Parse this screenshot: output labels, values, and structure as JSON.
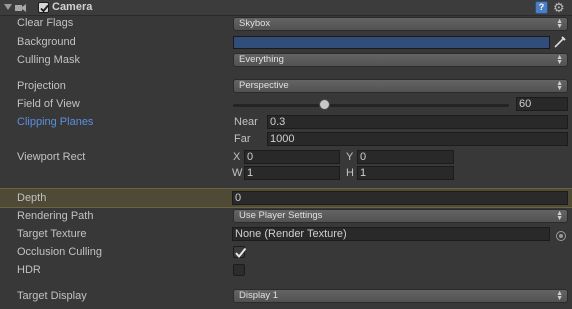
{
  "component": {
    "title": "Camera",
    "enabled": true,
    "icons": [
      "fold-arrow-icon",
      "camera-icon",
      "help-icon",
      "gear-icon"
    ]
  },
  "clear_flags": {
    "label": "Clear Flags",
    "value": "Skybox"
  },
  "background": {
    "label": "Background",
    "color": "#314d79"
  },
  "culling_mask": {
    "label": "Culling Mask",
    "value": "Everything"
  },
  "projection": {
    "label": "Projection",
    "value": "Perspective"
  },
  "field_of_view": {
    "label": "Field of View",
    "value": "60",
    "slider_fraction": 0.33
  },
  "clipping_planes": {
    "label": "Clipping Planes",
    "near_label": "Near",
    "near_value": "0.3",
    "far_label": "Far",
    "far_value": "1000"
  },
  "viewport_rect": {
    "label": "Viewport Rect",
    "x_label": "X",
    "x_value": "0",
    "y_label": "Y",
    "y_value": "0",
    "w_label": "W",
    "w_value": "1",
    "h_label": "H",
    "h_value": "1"
  },
  "depth": {
    "label": "Depth",
    "value": "0"
  },
  "rendering_path": {
    "label": "Rendering Path",
    "value": "Use Player Settings"
  },
  "target_texture": {
    "label": "Target Texture",
    "value": "None (Render Texture)"
  },
  "occlusion_culling": {
    "label": "Occlusion Culling",
    "checked": true
  },
  "hdr": {
    "label": "HDR",
    "checked": false
  },
  "target_display": {
    "label": "Target Display",
    "value": "Display 1"
  },
  "colors": {
    "accent_blue": "#5c8fe0",
    "highlight_row": "#4e4a35",
    "background": "#383838"
  }
}
